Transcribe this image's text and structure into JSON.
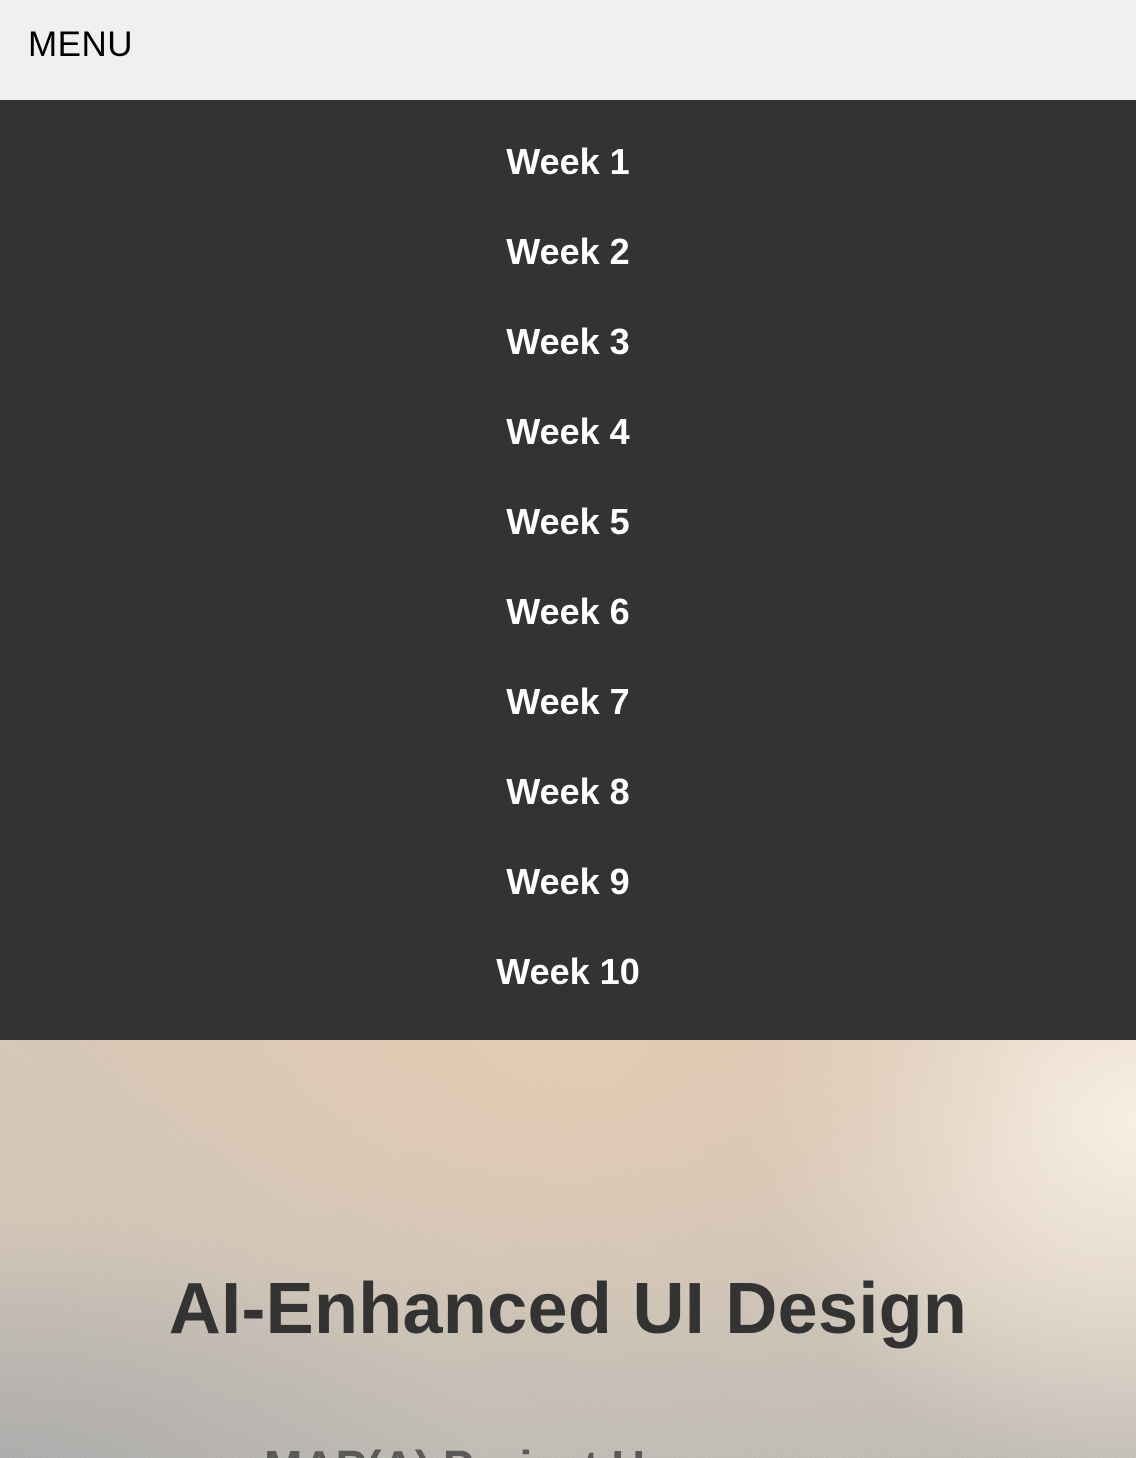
{
  "header": {
    "menu_label": "MENU"
  },
  "nav": {
    "items": [
      {
        "label": "Week 1"
      },
      {
        "label": "Week 2"
      },
      {
        "label": "Week 3"
      },
      {
        "label": "Week 4"
      },
      {
        "label": "Week 5"
      },
      {
        "label": "Week 6"
      },
      {
        "label": "Week 7"
      },
      {
        "label": "Week 8"
      },
      {
        "label": "Week 9"
      },
      {
        "label": "Week 10"
      }
    ]
  },
  "hero": {
    "title": "AI-Enhanced UI Design",
    "subtitle_partial": "MAP(A) Project U..."
  },
  "colors": {
    "topbar_bg": "#f0f0f0",
    "nav_bg": "#333333",
    "nav_text": "#ffffff",
    "title_text": "#333333"
  }
}
